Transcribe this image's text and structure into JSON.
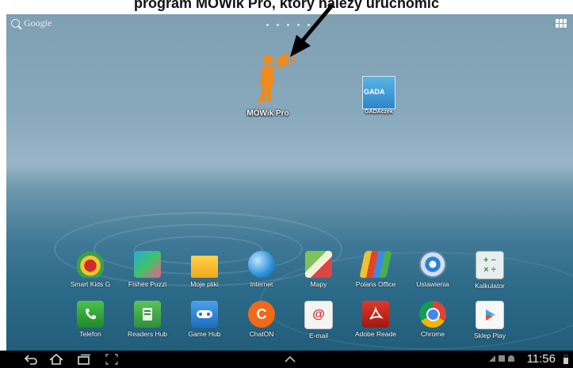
{
  "caption": "program MÓWik Pro, który należy uruchomić",
  "search": {
    "label": "Google"
  },
  "home_shortcuts": {
    "mowik": {
      "label": "MÓWik Pro"
    },
    "gada": {
      "label": "GADAczek",
      "tile_text": "GADA"
    }
  },
  "dock_row_1": [
    {
      "label": "Smart Kids G",
      "icon": "smart-kids-icon"
    },
    {
      "label": "Fishes Puzzl",
      "icon": "fishes-puzzle-icon"
    },
    {
      "label": "Moje pliki",
      "icon": "folder-icon"
    },
    {
      "label": "Internet",
      "icon": "globe-icon"
    },
    {
      "label": "Mapy",
      "icon": "maps-icon"
    },
    {
      "label": "Polaris Office",
      "icon": "polaris-office-icon"
    },
    {
      "label": "Ustawienia",
      "icon": "gear-icon"
    },
    {
      "label": "Kalkulator",
      "icon": "calculator-icon"
    }
  ],
  "dock_row_2": [
    {
      "label": "Telefon",
      "icon": "phone-icon"
    },
    {
      "label": "Readers Hub",
      "icon": "book-icon"
    },
    {
      "label": "Game Hub",
      "icon": "gamepad-icon"
    },
    {
      "label": "ChatON",
      "icon": "chaton-icon"
    },
    {
      "label": "E-mail",
      "icon": "email-icon"
    },
    {
      "label": "Adobe Reade",
      "icon": "adobe-reader-icon"
    },
    {
      "label": "Chrome",
      "icon": "chrome-icon"
    },
    {
      "label": "Sklep Play",
      "icon": "play-store-icon"
    }
  ],
  "dock_icon_glyphs": {
    "calculator": "+ −\n× ÷",
    "chaton": "C",
    "email": "@"
  },
  "status_bar": {
    "time": "11:56"
  }
}
